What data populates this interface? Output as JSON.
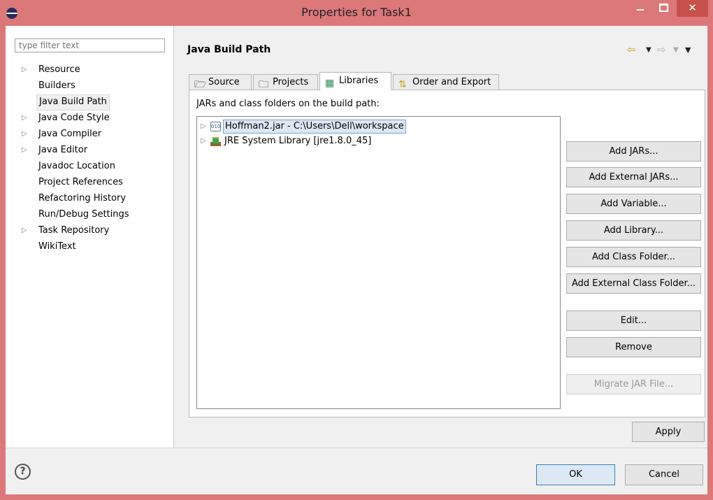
{
  "window": {
    "title": "Properties for Task1",
    "minimize_glyph": "",
    "maximize_glyph": "",
    "close_glyph": "✕"
  },
  "sidebar": {
    "filter_placeholder": "type filter text",
    "items": [
      {
        "label": "Resource",
        "expandable": true
      },
      {
        "label": "Builders",
        "expandable": false
      },
      {
        "label": "Java Build Path",
        "expandable": false,
        "selected": true
      },
      {
        "label": "Java Code Style",
        "expandable": true
      },
      {
        "label": "Java Compiler",
        "expandable": true
      },
      {
        "label": "Java Editor",
        "expandable": true
      },
      {
        "label": "Javadoc Location",
        "expandable": false
      },
      {
        "label": "Project References",
        "expandable": false
      },
      {
        "label": "Refactoring History",
        "expandable": false
      },
      {
        "label": "Run/Debug Settings",
        "expandable": false
      },
      {
        "label": "Task Repository",
        "expandable": true
      },
      {
        "label": "WikiText",
        "expandable": false
      }
    ]
  },
  "page": {
    "title": "Java Build Path",
    "tabs": [
      {
        "label": "Source",
        "icon": "source-icon"
      },
      {
        "label": "Projects",
        "icon": "folder-icon"
      },
      {
        "label": "Libraries",
        "icon": "library-icon",
        "active": true
      },
      {
        "label": "Order and Export",
        "icon": "order-icon"
      }
    ],
    "caption": "JARs and class folders on the build path:",
    "entries": [
      {
        "label": "Hoffman2.jar - C:\\Users\\Dell\\workspace",
        "icon": "jar-icon",
        "icon_text": "010",
        "selected": true
      },
      {
        "label": "JRE System Library [jre1.8.0_45]",
        "icon": "library-icon"
      }
    ],
    "buttons": {
      "add_jars": "Add JARs...",
      "add_external_jars": "Add External JARs...",
      "add_variable": "Add Variable...",
      "add_library": "Add Library...",
      "add_class_folder": "Add Class Folder...",
      "add_external_class_folder": "Add External Class Folder...",
      "edit": "Edit...",
      "remove": "Remove",
      "migrate_jar": "Migrate JAR File..."
    },
    "apply_label": "Apply"
  },
  "footer": {
    "help_glyph": "?",
    "ok_label": "OK",
    "cancel_label": "Cancel"
  },
  "colors": {
    "titlebar": "#dd787a",
    "close_button": "#c7504b",
    "selection": "#dde8f3",
    "selection_border": "#7da2ce",
    "dialog_bg": "#f0f0f0"
  }
}
